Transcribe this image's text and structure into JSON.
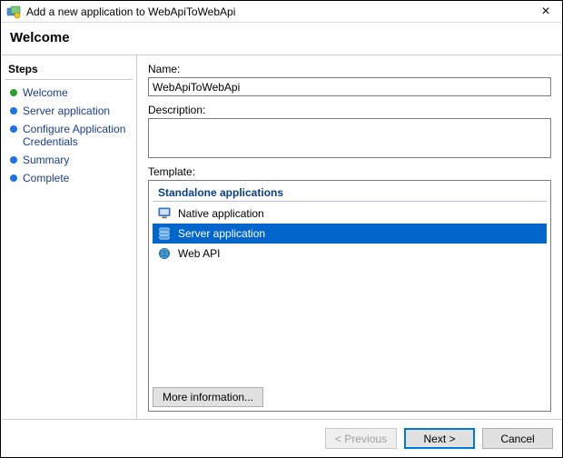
{
  "window": {
    "title": "Add a new application to WebApiToWebApi"
  },
  "heading": "Welcome",
  "sidebar": {
    "title": "Steps",
    "items": [
      {
        "label": "Welcome",
        "state": "current"
      },
      {
        "label": "Server application",
        "state": "pending"
      },
      {
        "label": "Configure Application Credentials",
        "state": "pending"
      },
      {
        "label": "Summary",
        "state": "pending"
      },
      {
        "label": "Complete",
        "state": "pending"
      }
    ]
  },
  "fields": {
    "name_label": "Name:",
    "name_value": "WebApiToWebApi",
    "desc_label": "Description:",
    "desc_value": "",
    "template_label": "Template:"
  },
  "templates": {
    "group_header": "Standalone applications",
    "items": [
      {
        "label": "Native application",
        "selected": false
      },
      {
        "label": "Server application",
        "selected": true
      },
      {
        "label": "Web API",
        "selected": false
      }
    ],
    "more_info": "More information..."
  },
  "buttons": {
    "previous": "< Previous",
    "next": "Next >",
    "cancel": "Cancel"
  }
}
